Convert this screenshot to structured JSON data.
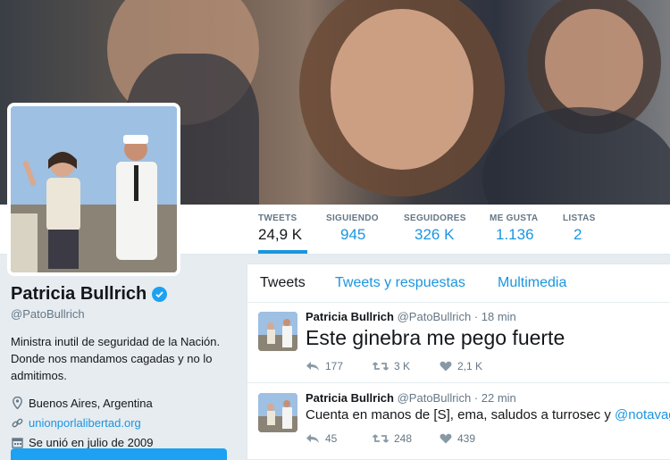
{
  "profile": {
    "name": "Patricia Bullrich",
    "handle": "@PatoBullrich",
    "bio": "Ministra inutil de seguridad de la Nación. Donde nos mandamos cagadas y no lo admitimos.",
    "location": "Buenos Aires, Argentina",
    "website": "unionporlalibertad.org",
    "joined": "Se unió en julio de 2009"
  },
  "stats": [
    {
      "label": "TWEETS",
      "value": "24,9 K"
    },
    {
      "label": "SIGUIENDO",
      "value": "945"
    },
    {
      "label": "SEGUIDORES",
      "value": "326 K"
    },
    {
      "label": "ME GUSTA",
      "value": "1.136"
    },
    {
      "label": "LISTAS",
      "value": "2"
    }
  ],
  "tabs": [
    "Tweets",
    "Tweets y respuestas",
    "Multimedia"
  ],
  "tweets": [
    {
      "name": "Patricia Bullrich",
      "handle": "@PatoBullrich",
      "time": "· 18 min",
      "text": "Este ginebra me pego fuerte",
      "replies": "177",
      "retweets": "3 K",
      "likes": "2,1 K"
    },
    {
      "name": "Patricia Bullrich",
      "handle": "@PatoBullrich",
      "time": "· 22 min",
      "text": "Cuenta en manos de [S], ema, saludos a turrosec y ",
      "mention": "@notavag",
      "replies": "45",
      "retweets": "248",
      "likes": "439"
    }
  ],
  "colors": {
    "accent": "#1b95e0",
    "verified": "#1da1f2",
    "muted": "#657786"
  },
  "icons": {
    "verified": "verified-badge-icon",
    "location": "location-pin-icon",
    "link": "link-icon",
    "calendar": "calendar-icon",
    "reply": "reply-icon",
    "retweet": "retweet-icon",
    "like": "heart-icon"
  }
}
